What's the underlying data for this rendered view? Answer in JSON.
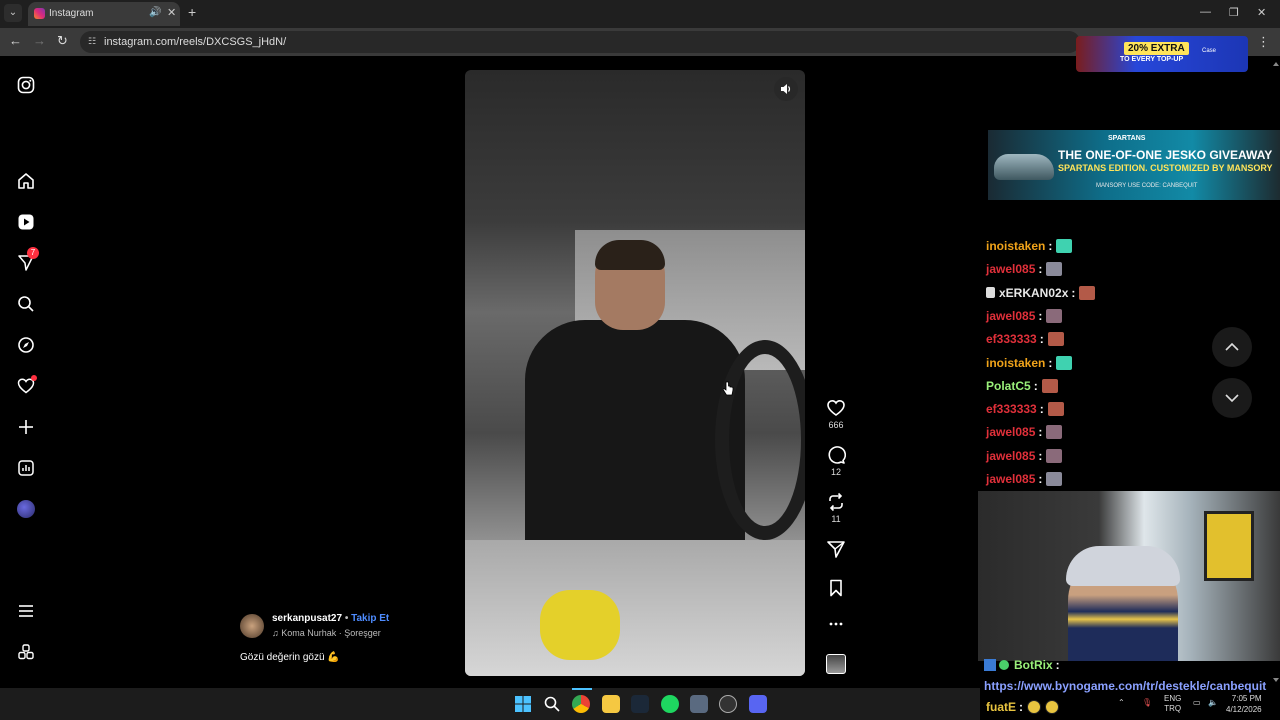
{
  "browser": {
    "tab_title": "Instagram",
    "url": "instagram.com/reels/DXCSGS_jHdN/"
  },
  "top_ad": {
    "badge": "20% EXTRA",
    "subtitle": "TO EVERY TOP-UP",
    "brand": "Case"
  },
  "sidebar": {
    "messages_badge": "7"
  },
  "reel": {
    "likes": "666",
    "comments": "12",
    "reposts": "11",
    "username": "serkanpusat27",
    "follow_label": "Takip Et",
    "music": "Koma Nurhak · Şoreşger",
    "caption": "Gözü değerin gözü"
  },
  "stream_ad": {
    "brand": "SPARTANS",
    "title": "THE ONE-OF-ONE JESKO GIVEAWAY",
    "subtitle": "SPARTANS EDITION. CUSTOMIZED BY MANSORY",
    "footer": "MANSORY    USE CODE: CANBEQUIT"
  },
  "chat": [
    {
      "user": "inoistaken",
      "color": "#f0a31a",
      "emote": "#3fd2b0"
    },
    {
      "user": "jawel085",
      "color": "#e0303a",
      "emote": "#8a8a9a"
    },
    {
      "user": "xERKAN02x",
      "color": "#e8e8e8",
      "emote": "#b35a48",
      "mod": true
    },
    {
      "user": "jawel085",
      "color": "#e0303a",
      "emote": "#8a6a7a"
    },
    {
      "user": "ef333333",
      "color": "#e0303a",
      "emote": "#b35a48"
    },
    {
      "user": "inoistaken",
      "color": "#f0a31a",
      "emote": "#3fd2b0"
    },
    {
      "user": "PolatC5",
      "color": "#9af07a",
      "emote": "#b35a48"
    },
    {
      "user": "ef333333",
      "color": "#e0303a",
      "emote": "#b35a48"
    },
    {
      "user": "jawel085",
      "color": "#e0303a",
      "emote": "#8a6a7a"
    },
    {
      "user": "jawel085",
      "color": "#e0303a",
      "emote": "#8a6a7a"
    },
    {
      "user": "jawel085",
      "color": "#e0303a",
      "emote": "#8a8a9a"
    }
  ],
  "bot": {
    "name": "BotRix",
    "link": "https://www.bynogame.com/tr/destekle/canbequit",
    "last_user": "fuatE"
  },
  "taskbar": {
    "lang_top": "ENG",
    "lang_bottom": "TRQ",
    "time": "7:05 PM",
    "date": "4/12/2026"
  }
}
